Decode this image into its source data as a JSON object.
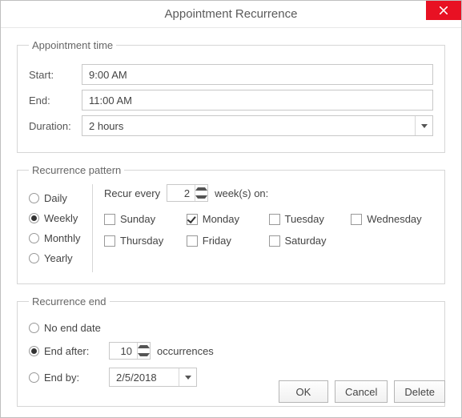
{
  "title": "Appointment Recurrence",
  "groups": {
    "time": "Appointment time",
    "pattern": "Recurrence pattern",
    "end": "Recurrence end"
  },
  "time": {
    "start_label": "Start:",
    "start_value": "9:00 AM",
    "end_label": "End:",
    "end_value": "11:00 AM",
    "duration_label": "Duration:",
    "duration_value": "2 hours"
  },
  "pattern": {
    "daily": "Daily",
    "weekly": "Weekly",
    "monthly": "Monthly",
    "yearly": "Yearly",
    "selected": "weekly",
    "recur_prefix": "Recur every",
    "recur_value": "2",
    "recur_suffix": "week(s) on:",
    "days": {
      "sun": "Sunday",
      "mon": "Monday",
      "tue": "Tuesday",
      "wed": "Wednesday",
      "thu": "Thursday",
      "fri": "Friday",
      "sat": "Saturday"
    },
    "days_checked": [
      "mon"
    ]
  },
  "end": {
    "no_end": "No end date",
    "end_after": "End after:",
    "occurrences_value": "10",
    "occurrences_suffix": "occurrences",
    "end_by": "End by:",
    "end_by_date": "2/5/2018",
    "selected": "end_after"
  },
  "buttons": {
    "ok": "OK",
    "cancel": "Cancel",
    "delete": "Delete"
  }
}
